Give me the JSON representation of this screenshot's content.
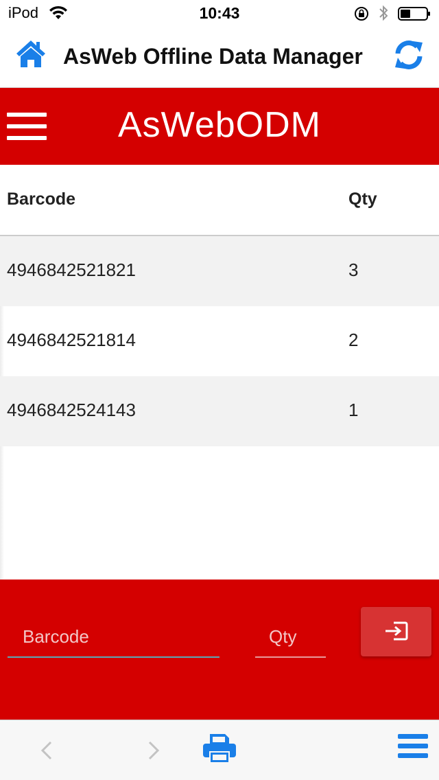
{
  "status_bar": {
    "carrier": "iPod",
    "time": "10:43"
  },
  "app_bar": {
    "title": "AsWeb Offline Data Manager",
    "home_icon": "home-icon",
    "refresh_icon": "refresh-icon"
  },
  "header": {
    "brand": "AsWebODM",
    "menu_icon": "hamburger-menu-icon"
  },
  "table": {
    "columns": [
      "Barcode",
      "Qty"
    ],
    "rows": [
      {
        "barcode": "4946842521821",
        "qty": "3"
      },
      {
        "barcode": "4946842521814",
        "qty": "2"
      },
      {
        "barcode": "4946842524143",
        "qty": "1"
      }
    ]
  },
  "entry": {
    "barcode_placeholder": "Barcode",
    "qty_placeholder": "Qty",
    "submit_icon": "sign-in-icon"
  },
  "toolbar": {
    "icons": [
      "back-icon",
      "forward-icon",
      "print-icon",
      "menu-icon"
    ]
  },
  "colors": {
    "brand_red": "#d40000",
    "ios_blue": "#1a7fe8",
    "row_alt": "#f2f2f2"
  }
}
